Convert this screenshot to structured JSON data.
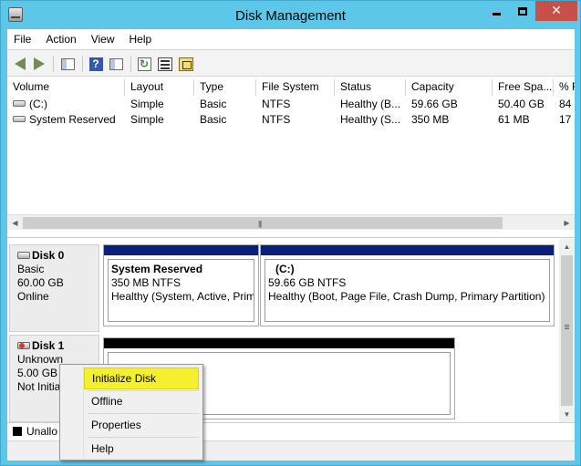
{
  "window": {
    "title": "Disk Management"
  },
  "menu": [
    "File",
    "Action",
    "View",
    "Help"
  ],
  "toolbar": {
    "icons": [
      "back-icon",
      "forward-icon",
      "show-hide-console-tree-icon",
      "help-icon",
      "show-action-pane-icon",
      "refresh-icon",
      "properties-icon",
      "rescan-disks-icon"
    ]
  },
  "volume_list": {
    "columns": [
      "Volume",
      "Layout",
      "Type",
      "File System",
      "Status",
      "Capacity",
      "Free Spa...",
      "% F"
    ],
    "rows": [
      {
        "volume": "(C:)",
        "layout": "Simple",
        "type": "Basic",
        "fs": "NTFS",
        "status": "Healthy (B...",
        "capacity": "59.66 GB",
        "free": "50.40 GB",
        "pct": "84"
      },
      {
        "volume": "System Reserved",
        "layout": "Simple",
        "type": "Basic",
        "fs": "NTFS",
        "status": "Healthy (S...",
        "capacity": "350 MB",
        "free": "61 MB",
        "pct": "17"
      }
    ]
  },
  "disks": [
    {
      "name": "Disk 0",
      "type": "Basic",
      "size": "60.00 GB",
      "state": "Online",
      "partitions": [
        {
          "name": "System Reserved",
          "size_fs": "350 MB NTFS",
          "status": "Healthy (System, Active, Prim"
        },
        {
          "name": "(C:)",
          "size_fs": "59.66 GB NTFS",
          "status": "Healthy (Boot, Page File, Crash Dump, Primary Partition)"
        }
      ]
    },
    {
      "name": "Disk 1",
      "type": "Unknown",
      "size": "5.00 GB",
      "state": "Not Initia"
    }
  ],
  "legend": {
    "label": "Unallo",
    "color": "#000000"
  },
  "context_menu": {
    "items": [
      "Initialize Disk",
      "Offline",
      "Properties",
      "Help"
    ],
    "highlighted": "Initialize Disk",
    "highlight_color": "#f4f02e"
  },
  "colors": {
    "titlebar": "#5cc7e8",
    "primary_partition_bar": "#0a1f7a",
    "unallocated_bar": "#000000"
  }
}
